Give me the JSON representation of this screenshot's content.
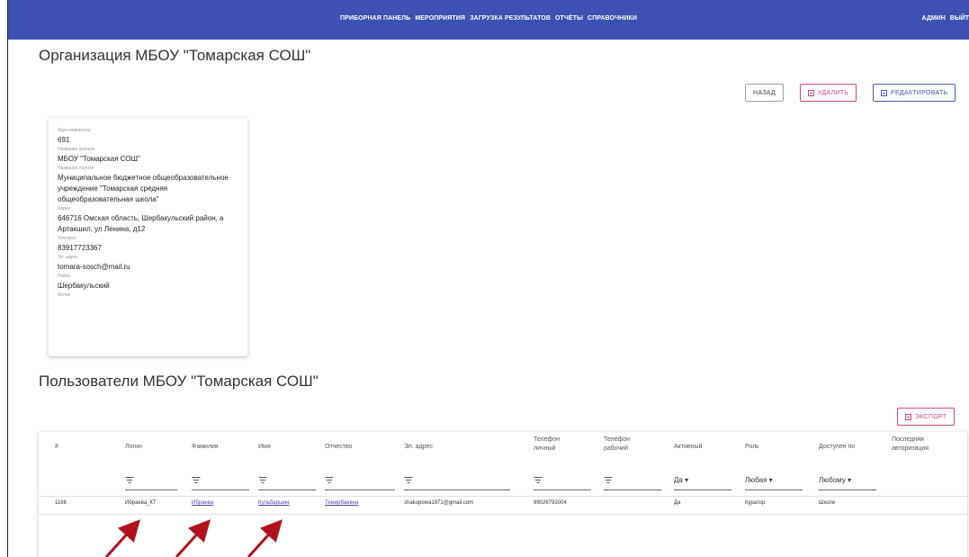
{
  "nav": {
    "items": [
      "ПРИБОРНАЯ ПАНЕЛЬ",
      "МЕРОПРИЯТИЯ",
      "ЗАГРУЗКА РЕЗУЛЬТАТОВ",
      "ОТЧЁТЫ",
      "СПРАВОЧНИКИ"
    ],
    "right": [
      "АДМИН",
      "ВЫЙТ"
    ]
  },
  "org": {
    "title": "Организация МБОУ \"Томарская СОШ\"",
    "buttons": {
      "back": "НАЗАД",
      "delete": "УДАЛИТЬ",
      "edit": "РЕДАКТИРОВАТЬ"
    }
  },
  "card": {
    "id_label": "Идентификатор",
    "id_value": "691",
    "short_label": "Название краткое",
    "short_value": "МБОУ \"Томарская СОШ\"",
    "full_label": "Название полное",
    "full_value": "Муниципальное бюджетное общеобразовательное учреждение \"Томарская средняя общеобразовательная школа\"",
    "address_label": "Адрес",
    "address_value": "646716 Омская область, Шербакульский район, а Артакшил, ул Ленина, д12",
    "phone_label": "Телефон",
    "phone_value": "83917723367",
    "email_label": "Эл. адрес",
    "email_value": "tomara-sosch@mail.ru",
    "district_label": "Район",
    "district_value": "Шербакульский",
    "tags_label": "Метки"
  },
  "users": {
    "title": "Пользователи МБОУ \"Томарская СОШ\"",
    "export_label": "ЭКСПОРТ",
    "columns": {
      "num": "#",
      "login": "Логин",
      "surname": "Фамилия",
      "name": "Имя",
      "patronymic": "Отчество",
      "email": "Эл. адрес",
      "phone_personal": "Телефон личный",
      "phone_work": "Телефон рабочий",
      "active": "Активный",
      "role": "Роль",
      "access": "Доступен по",
      "last_auth": "Последняя авторизация"
    },
    "filters": {
      "active": "Да ▾",
      "role": "Любая ▾",
      "access": "Любому ▾"
    },
    "row": {
      "num": "1186",
      "login": "Ибраева_КТ",
      "surname": "Ибраева",
      "name": "Кульбаршин",
      "patronymic": "Темирбаевна",
      "email": "shakupowa1971@gmail.com",
      "phone_personal": "89026793004",
      "phone_work": "",
      "active": "Да",
      "role": "Куратор",
      "access": "Школе",
      "last_auth": ""
    }
  },
  "colors": {
    "topbar": "#3d51b3",
    "delete": "#d64580",
    "edit": "#4b56c2",
    "link": "#5a3fb7",
    "arrow": "#b0121c"
  }
}
